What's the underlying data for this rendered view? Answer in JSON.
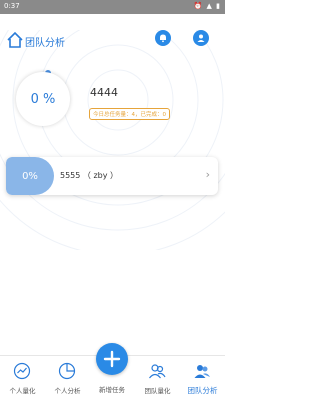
{
  "statusbar": {
    "time": "0:37",
    "icons": "⏰ ▲ ▮"
  },
  "header": {
    "title": "团队分析"
  },
  "summary": {
    "progress_percent": "0 %",
    "team_name": "4444",
    "task_badge": "今日总任务量：4，已完成：0"
  },
  "members": [
    {
      "percent": "0%",
      "name": "5555 （ zby ）"
    }
  ],
  "tabbar": {
    "items": [
      "个人量化",
      "个人分析",
      "新增任务",
      "团队量化",
      "团队分析"
    ],
    "active_index": 4
  },
  "colors": {
    "accent": "#2a8ae6",
    "badge": "#e6a43a",
    "member_fill": "#8ab6e8"
  }
}
